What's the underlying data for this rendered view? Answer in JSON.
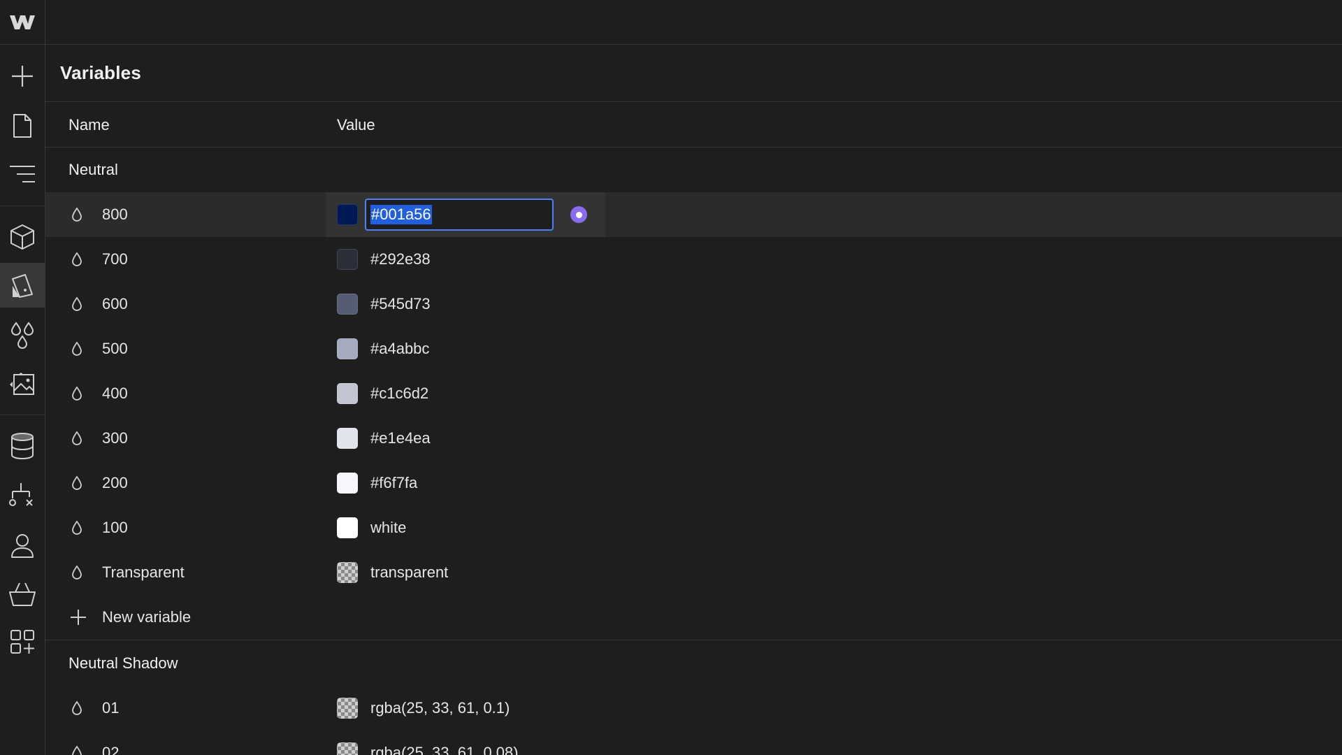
{
  "rail": {
    "logo": "webflow-logo-icon",
    "items": [
      {
        "icon": "add-icon"
      },
      {
        "icon": "page-icon"
      },
      {
        "icon": "navigator-icon"
      },
      {
        "icon": "components-icon"
      },
      {
        "icon": "style-selector-icon",
        "active": true
      },
      {
        "icon": "variables-icon"
      },
      {
        "icon": "assets-icon"
      },
      {
        "icon": "cms-database-icon"
      },
      {
        "icon": "logic-icon"
      },
      {
        "icon": "users-icon"
      },
      {
        "icon": "ecommerce-basket-icon"
      },
      {
        "icon": "apps-icon"
      }
    ]
  },
  "panel": {
    "title": "Variables",
    "columns": {
      "name": "Name",
      "value": "Value"
    }
  },
  "groups": [
    {
      "title": "Neutral",
      "variables": [
        {
          "name": "800",
          "value": "#001a56",
          "swatch": "#001a56",
          "selected": true
        },
        {
          "name": "700",
          "value": "#292e38",
          "swatch": "#292e38"
        },
        {
          "name": "600",
          "value": "#545d73",
          "swatch": "#545d73"
        },
        {
          "name": "500",
          "value": "#a4abbc",
          "swatch": "#a4abbc"
        },
        {
          "name": "400",
          "value": "#c1c6d2",
          "swatch": "#c1c6d2"
        },
        {
          "name": "300",
          "value": "#e1e4ea",
          "swatch": "#e1e4ea"
        },
        {
          "name": "200",
          "value": "#f6f7fa",
          "swatch": "#f6f7fa"
        },
        {
          "name": "100",
          "value": "white",
          "swatch": "#ffffff"
        },
        {
          "name": "Transparent",
          "value": "transparent",
          "swatch": "checker"
        }
      ],
      "new_variable_label": "New variable"
    },
    {
      "title": "Neutral Shadow",
      "variables": [
        {
          "name": "01",
          "value": "rgba(25, 33, 61, 0.1)",
          "swatch": "checker"
        },
        {
          "name": "02",
          "value": "rgba(25, 33, 61, 0.08)",
          "swatch": "checker"
        }
      ]
    }
  ],
  "colors": {
    "background": "#1e1e1e",
    "border": "#363636",
    "selection": "#1f5fe0",
    "focus_ring": "#4f7ff5",
    "bind_accent": "#8a6cf0"
  }
}
